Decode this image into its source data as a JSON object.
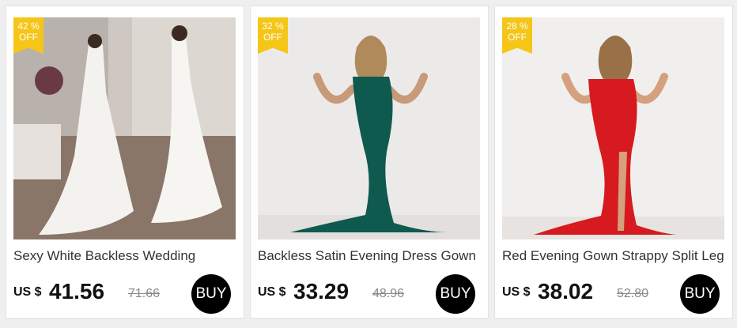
{
  "products": [
    {
      "discount_value": "42 %",
      "discount_label": "OFF",
      "title": "Sexy White Backless Wedding",
      "currency": "US $",
      "price": "41.56",
      "old_price": "71.66",
      "buy_label": "BUY"
    },
    {
      "discount_value": "32 %",
      "discount_label": "OFF",
      "title": "Backless Satin Evening Dress Gown",
      "currency": "US $",
      "price": "33.29",
      "old_price": "48.96",
      "buy_label": "BUY"
    },
    {
      "discount_value": "28 %",
      "discount_label": "OFF",
      "title": "Red Evening Gown Strappy Split Leg",
      "currency": "US $",
      "price": "38.02",
      "old_price": "52.80",
      "buy_label": "BUY"
    }
  ],
  "colors": {
    "badge": "#f5c518",
    "buy_button": "#000000",
    "white_gown": "#f2f0ec",
    "green_gown": "#0e5a4e",
    "red_gown": "#d61a1f"
  }
}
